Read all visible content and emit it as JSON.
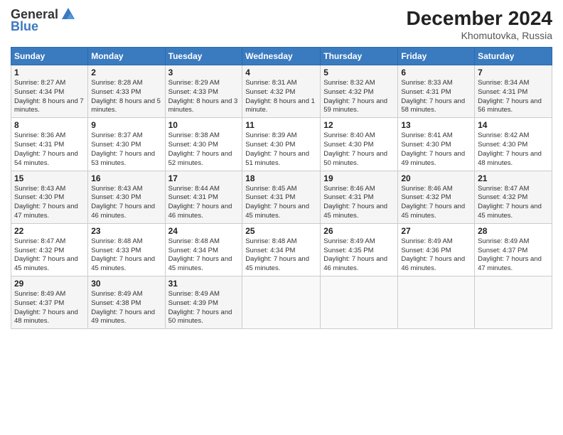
{
  "header": {
    "logo_general": "General",
    "logo_blue": "Blue",
    "title": "December 2024",
    "subtitle": "Khomutovka, Russia"
  },
  "columns": [
    "Sunday",
    "Monday",
    "Tuesday",
    "Wednesday",
    "Thursday",
    "Friday",
    "Saturday"
  ],
  "weeks": [
    [
      {
        "day": "1",
        "sunrise": "Sunrise: 8:27 AM",
        "sunset": "Sunset: 4:34 PM",
        "daylight": "Daylight: 8 hours and 7 minutes."
      },
      {
        "day": "2",
        "sunrise": "Sunrise: 8:28 AM",
        "sunset": "Sunset: 4:33 PM",
        "daylight": "Daylight: 8 hours and 5 minutes."
      },
      {
        "day": "3",
        "sunrise": "Sunrise: 8:29 AM",
        "sunset": "Sunset: 4:33 PM",
        "daylight": "Daylight: 8 hours and 3 minutes."
      },
      {
        "day": "4",
        "sunrise": "Sunrise: 8:31 AM",
        "sunset": "Sunset: 4:32 PM",
        "daylight": "Daylight: 8 hours and 1 minute."
      },
      {
        "day": "5",
        "sunrise": "Sunrise: 8:32 AM",
        "sunset": "Sunset: 4:32 PM",
        "daylight": "Daylight: 7 hours and 59 minutes."
      },
      {
        "day": "6",
        "sunrise": "Sunrise: 8:33 AM",
        "sunset": "Sunset: 4:31 PM",
        "daylight": "Daylight: 7 hours and 58 minutes."
      },
      {
        "day": "7",
        "sunrise": "Sunrise: 8:34 AM",
        "sunset": "Sunset: 4:31 PM",
        "daylight": "Daylight: 7 hours and 56 minutes."
      }
    ],
    [
      {
        "day": "8",
        "sunrise": "Sunrise: 8:36 AM",
        "sunset": "Sunset: 4:31 PM",
        "daylight": "Daylight: 7 hours and 54 minutes."
      },
      {
        "day": "9",
        "sunrise": "Sunrise: 8:37 AM",
        "sunset": "Sunset: 4:30 PM",
        "daylight": "Daylight: 7 hours and 53 minutes."
      },
      {
        "day": "10",
        "sunrise": "Sunrise: 8:38 AM",
        "sunset": "Sunset: 4:30 PM",
        "daylight": "Daylight: 7 hours and 52 minutes."
      },
      {
        "day": "11",
        "sunrise": "Sunrise: 8:39 AM",
        "sunset": "Sunset: 4:30 PM",
        "daylight": "Daylight: 7 hours and 51 minutes."
      },
      {
        "day": "12",
        "sunrise": "Sunrise: 8:40 AM",
        "sunset": "Sunset: 4:30 PM",
        "daylight": "Daylight: 7 hours and 50 minutes."
      },
      {
        "day": "13",
        "sunrise": "Sunrise: 8:41 AM",
        "sunset": "Sunset: 4:30 PM",
        "daylight": "Daylight: 7 hours and 49 minutes."
      },
      {
        "day": "14",
        "sunrise": "Sunrise: 8:42 AM",
        "sunset": "Sunset: 4:30 PM",
        "daylight": "Daylight: 7 hours and 48 minutes."
      }
    ],
    [
      {
        "day": "15",
        "sunrise": "Sunrise: 8:43 AM",
        "sunset": "Sunset: 4:30 PM",
        "daylight": "Daylight: 7 hours and 47 minutes."
      },
      {
        "day": "16",
        "sunrise": "Sunrise: 8:43 AM",
        "sunset": "Sunset: 4:30 PM",
        "daylight": "Daylight: 7 hours and 46 minutes."
      },
      {
        "day": "17",
        "sunrise": "Sunrise: 8:44 AM",
        "sunset": "Sunset: 4:31 PM",
        "daylight": "Daylight: 7 hours and 46 minutes."
      },
      {
        "day": "18",
        "sunrise": "Sunrise: 8:45 AM",
        "sunset": "Sunset: 4:31 PM",
        "daylight": "Daylight: 7 hours and 45 minutes."
      },
      {
        "day": "19",
        "sunrise": "Sunrise: 8:46 AM",
        "sunset": "Sunset: 4:31 PM",
        "daylight": "Daylight: 7 hours and 45 minutes."
      },
      {
        "day": "20",
        "sunrise": "Sunrise: 8:46 AM",
        "sunset": "Sunset: 4:32 PM",
        "daylight": "Daylight: 7 hours and 45 minutes."
      },
      {
        "day": "21",
        "sunrise": "Sunrise: 8:47 AM",
        "sunset": "Sunset: 4:32 PM",
        "daylight": "Daylight: 7 hours and 45 minutes."
      }
    ],
    [
      {
        "day": "22",
        "sunrise": "Sunrise: 8:47 AM",
        "sunset": "Sunset: 4:32 PM",
        "daylight": "Daylight: 7 hours and 45 minutes."
      },
      {
        "day": "23",
        "sunrise": "Sunrise: 8:48 AM",
        "sunset": "Sunset: 4:33 PM",
        "daylight": "Daylight: 7 hours and 45 minutes."
      },
      {
        "day": "24",
        "sunrise": "Sunrise: 8:48 AM",
        "sunset": "Sunset: 4:34 PM",
        "daylight": "Daylight: 7 hours and 45 minutes."
      },
      {
        "day": "25",
        "sunrise": "Sunrise: 8:48 AM",
        "sunset": "Sunset: 4:34 PM",
        "daylight": "Daylight: 7 hours and 45 minutes."
      },
      {
        "day": "26",
        "sunrise": "Sunrise: 8:49 AM",
        "sunset": "Sunset: 4:35 PM",
        "daylight": "Daylight: 7 hours and 46 minutes."
      },
      {
        "day": "27",
        "sunrise": "Sunrise: 8:49 AM",
        "sunset": "Sunset: 4:36 PM",
        "daylight": "Daylight: 7 hours and 46 minutes."
      },
      {
        "day": "28",
        "sunrise": "Sunrise: 8:49 AM",
        "sunset": "Sunset: 4:37 PM",
        "daylight": "Daylight: 7 hours and 47 minutes."
      }
    ],
    [
      {
        "day": "29",
        "sunrise": "Sunrise: 8:49 AM",
        "sunset": "Sunset: 4:37 PM",
        "daylight": "Daylight: 7 hours and 48 minutes."
      },
      {
        "day": "30",
        "sunrise": "Sunrise: 8:49 AM",
        "sunset": "Sunset: 4:38 PM",
        "daylight": "Daylight: 7 hours and 49 minutes."
      },
      {
        "day": "31",
        "sunrise": "Sunrise: 8:49 AM",
        "sunset": "Sunset: 4:39 PM",
        "daylight": "Daylight: 7 hours and 50 minutes."
      },
      null,
      null,
      null,
      null
    ]
  ]
}
